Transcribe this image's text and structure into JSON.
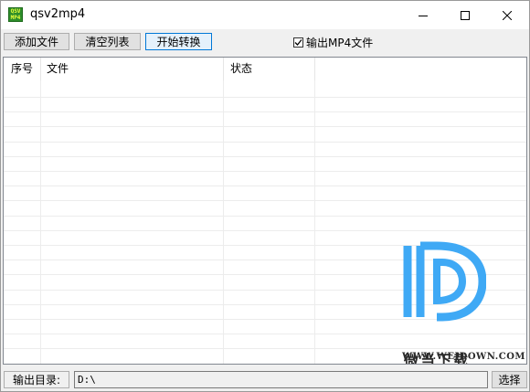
{
  "window": {
    "title": "qsv2mp4",
    "icon_lines": [
      "QSV",
      "MP4"
    ],
    "controls": [
      "minimize-icon",
      "maximize-icon",
      "close-icon"
    ]
  },
  "toolbar": {
    "add_file_label": "添加文件",
    "clear_list_label": "清空列表",
    "start_convert_label": "开始转换",
    "output_mp4_label": "输出MP4文件",
    "output_mp4_checked": true
  },
  "list": {
    "columns": [
      "序号",
      "文件",
      "状态"
    ],
    "rows": []
  },
  "watermark": {
    "brand": "微当下载",
    "url": "WWW.WEIDOWN.COM",
    "color": "#3fa9f5"
  },
  "footer": {
    "output_dir_label": "输出目录:",
    "output_dir_value": "D:\\",
    "choose_label": "选择"
  }
}
